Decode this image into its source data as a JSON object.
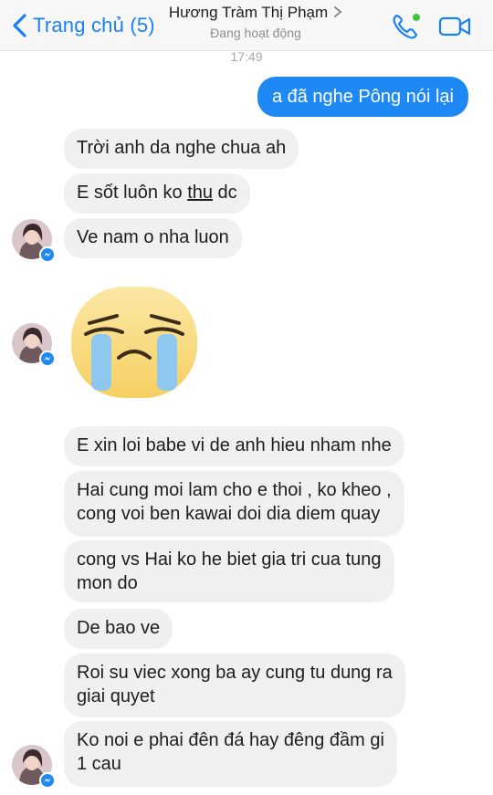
{
  "header": {
    "back_label": "Trang chủ (5)",
    "contact_name": "Hương Tràm Thị Phạm",
    "status": "Đang hoạt động",
    "icons": [
      "back-chevron-icon",
      "phone-icon",
      "video-camera-icon"
    ],
    "accent_color": "#1a82f7",
    "online_color": "#3ec43a"
  },
  "conversation": {
    "timestamp": "17:49",
    "sent": [
      "a đã nghe Pông nói lại"
    ],
    "group1": [
      "Trời anh da nghe chua ah",
      "Ve nam o nha luon"
    ],
    "group1_underlined_pre": "E sốt luôn ko ",
    "group1_underlined_word": "thu",
    "group1_underlined_post": " dc",
    "sticker": "crying-face-sticker",
    "group2": [
      "E xin loi babe vi de anh hieu nham nhe",
      "Hai cung moi lam cho e thoi , ko kheo ,",
      "cong voi ben kawai doi dia diem quay",
      "cong vs Hai ko he biet gia tri cua tung",
      "mon do",
      "De bao ve",
      "Roi su viec xong ba ay cung tu dung ra",
      "giai quyet",
      "Ko noi e phai đên đá hay đêng đầm gi",
      "1 cau"
    ],
    "bubble_color_in": "#f0f0f0",
    "bubble_color_out": "#1e88f5"
  }
}
